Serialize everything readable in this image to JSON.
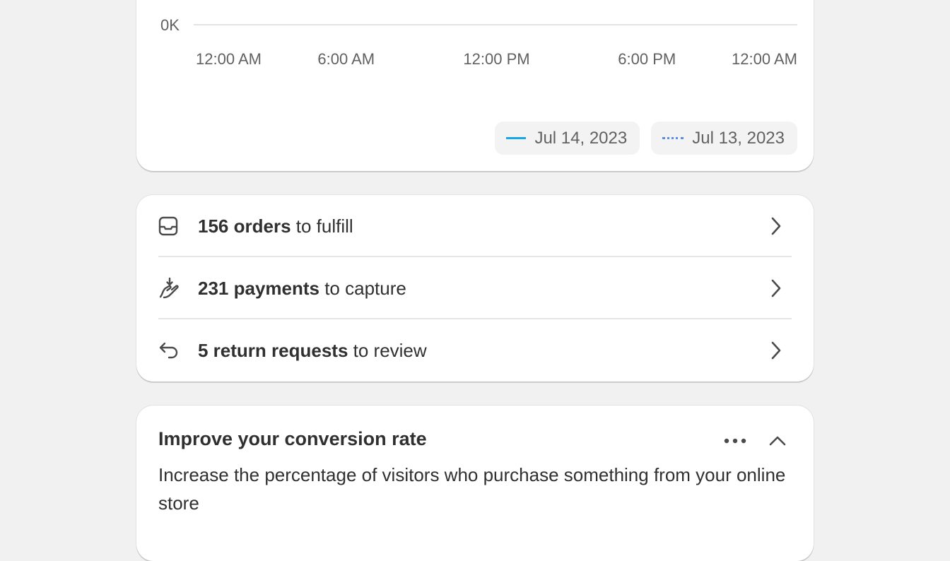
{
  "chart_data": {
    "type": "line",
    "y_ticks": [
      "0K"
    ],
    "x_ticks": [
      "12:00 AM",
      "6:00 AM",
      "12:00 PM",
      "6:00 PM",
      "12:00 AM"
    ],
    "series": [
      {
        "name": "Jul 14, 2023",
        "style": "solid",
        "color": "#1aa7e8"
      },
      {
        "name": "Jul 13, 2023",
        "style": "dotted",
        "color": "#5a8ee6"
      }
    ],
    "grid": true,
    "legend_position": "bottom-right"
  },
  "tasks": [
    {
      "count": "156 orders",
      "rest": " to fulfill",
      "icon": "inbox-icon"
    },
    {
      "count": "231 payments",
      "rest": " to capture",
      "icon": "hand-coin-icon"
    },
    {
      "count": "5 return requests",
      "rest": " to review",
      "icon": "return-arrow-icon"
    }
  ],
  "conversion": {
    "title": "Improve your conversion rate",
    "description": "Increase the percentage of visitors who purchase something from your online store"
  },
  "colors": {
    "background": "#f1f1f1",
    "card": "#ffffff",
    "text": "#303030",
    "muted": "#616161"
  }
}
